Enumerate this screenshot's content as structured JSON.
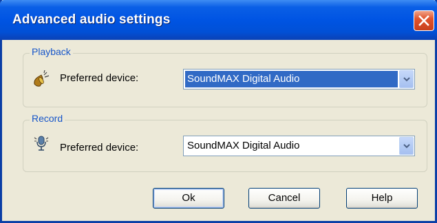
{
  "window": {
    "title": "Advanced audio settings"
  },
  "playback": {
    "legend": "Playback",
    "label": "Preferred device:",
    "device": "SoundMAX Digital Audio",
    "icon": "speaker-icon"
  },
  "record": {
    "legend": "Record",
    "label": "Preferred device:",
    "device": "SoundMAX Digital Audio",
    "icon": "microphone-icon"
  },
  "buttons": {
    "ok": "Ok",
    "cancel": "Cancel",
    "help": "Help"
  },
  "colors": {
    "titlebar": "#0054e3",
    "legend": "#1655c9",
    "selection": "#316ac5",
    "close": "#e0532c"
  }
}
